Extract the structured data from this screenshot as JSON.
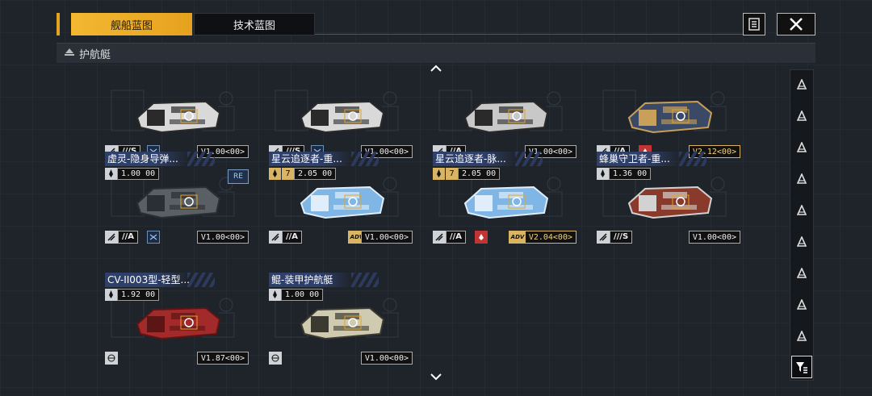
{
  "tabs": [
    {
      "label": "舰船蓝图",
      "active": true
    },
    {
      "label": "技术蓝图",
      "active": false
    }
  ],
  "section": {
    "label": "护航艇"
  },
  "colors": {
    "accent": "#e6a21e",
    "title_bg": "#2e3f6a",
    "red_tag": "#c23333"
  },
  "cards": [
    {
      "title": "",
      "value": "",
      "value_num": "",
      "class_label": "///S",
      "class_icon": "frigate-icon",
      "extra": "blue",
      "version": "V1.00<00>",
      "version_gold": false,
      "re": false
    },
    {
      "title": "",
      "value": "",
      "value_num": "",
      "class_label": "///S",
      "class_icon": "frigate-icon",
      "extra": "blue",
      "version": "V1.00<00>",
      "version_gold": false,
      "re": false
    },
    {
      "title": "",
      "value": "",
      "value_num": "",
      "class_label": "//A",
      "class_icon": "strike-icon",
      "extra": "",
      "version": "V1.00<00>",
      "version_gold": false,
      "re": false
    },
    {
      "title": "",
      "value": "",
      "value_num": "",
      "class_label": "//A",
      "class_icon": "strike-icon",
      "extra": "red",
      "version": "V2.12<00>",
      "version_gold": true,
      "re": false
    },
    {
      "title": "虚灵-隐身导弹...",
      "value": "1.00 00",
      "value_num": "",
      "class_label": "//A",
      "class_icon": "strike-icon",
      "extra": "blue",
      "version": "V1.00<00>",
      "version_gold": false,
      "re": true,
      "re_label": "RE"
    },
    {
      "title": "星云追逐者-重...",
      "value": "2.05 00",
      "value_num": "7",
      "class_label": "//A",
      "class_icon": "strike-icon",
      "extra": "",
      "adv": "ADV",
      "version": "V1.00<00>",
      "version_gold": false,
      "re": false
    },
    {
      "title": "星云追逐者-脉...",
      "value": "2.05 00",
      "value_num": "7",
      "class_label": "//A",
      "class_icon": "strike-icon",
      "extra": "red",
      "adv": "ADV",
      "version": "V2.04<00>",
      "version_gold": true,
      "re": false
    },
    {
      "title": "蜂巢守卫者-重...",
      "value": "1.36 00",
      "value_num": "",
      "class_label": "///S",
      "class_icon": "strike-icon",
      "extra": "",
      "version": "V1.00<00>",
      "version_gold": false,
      "re": false
    },
    {
      "title": "CV-II003型-轻型...",
      "value": "1.92 00",
      "value_num": "",
      "class_label": "",
      "class_icon": "",
      "extra": "",
      "version": "V1.87<00>",
      "version_gold": false,
      "re": false
    },
    {
      "title": "鲲-装甲护航艇",
      "value": "1.00 00",
      "value_num": "",
      "class_label": "",
      "class_icon": "",
      "extra": "",
      "version": "V1.00<00>",
      "version_gold": false,
      "re": false
    }
  ],
  "sidebar_icons": [
    "hull-type-1-icon",
    "hull-type-2-icon",
    "hull-type-3-icon",
    "hull-type-4-icon",
    "hull-type-5-icon",
    "hull-type-6-icon",
    "hull-type-7-icon",
    "hull-type-8-icon",
    "hull-type-9-icon"
  ],
  "filter_icon": "filter-icon"
}
